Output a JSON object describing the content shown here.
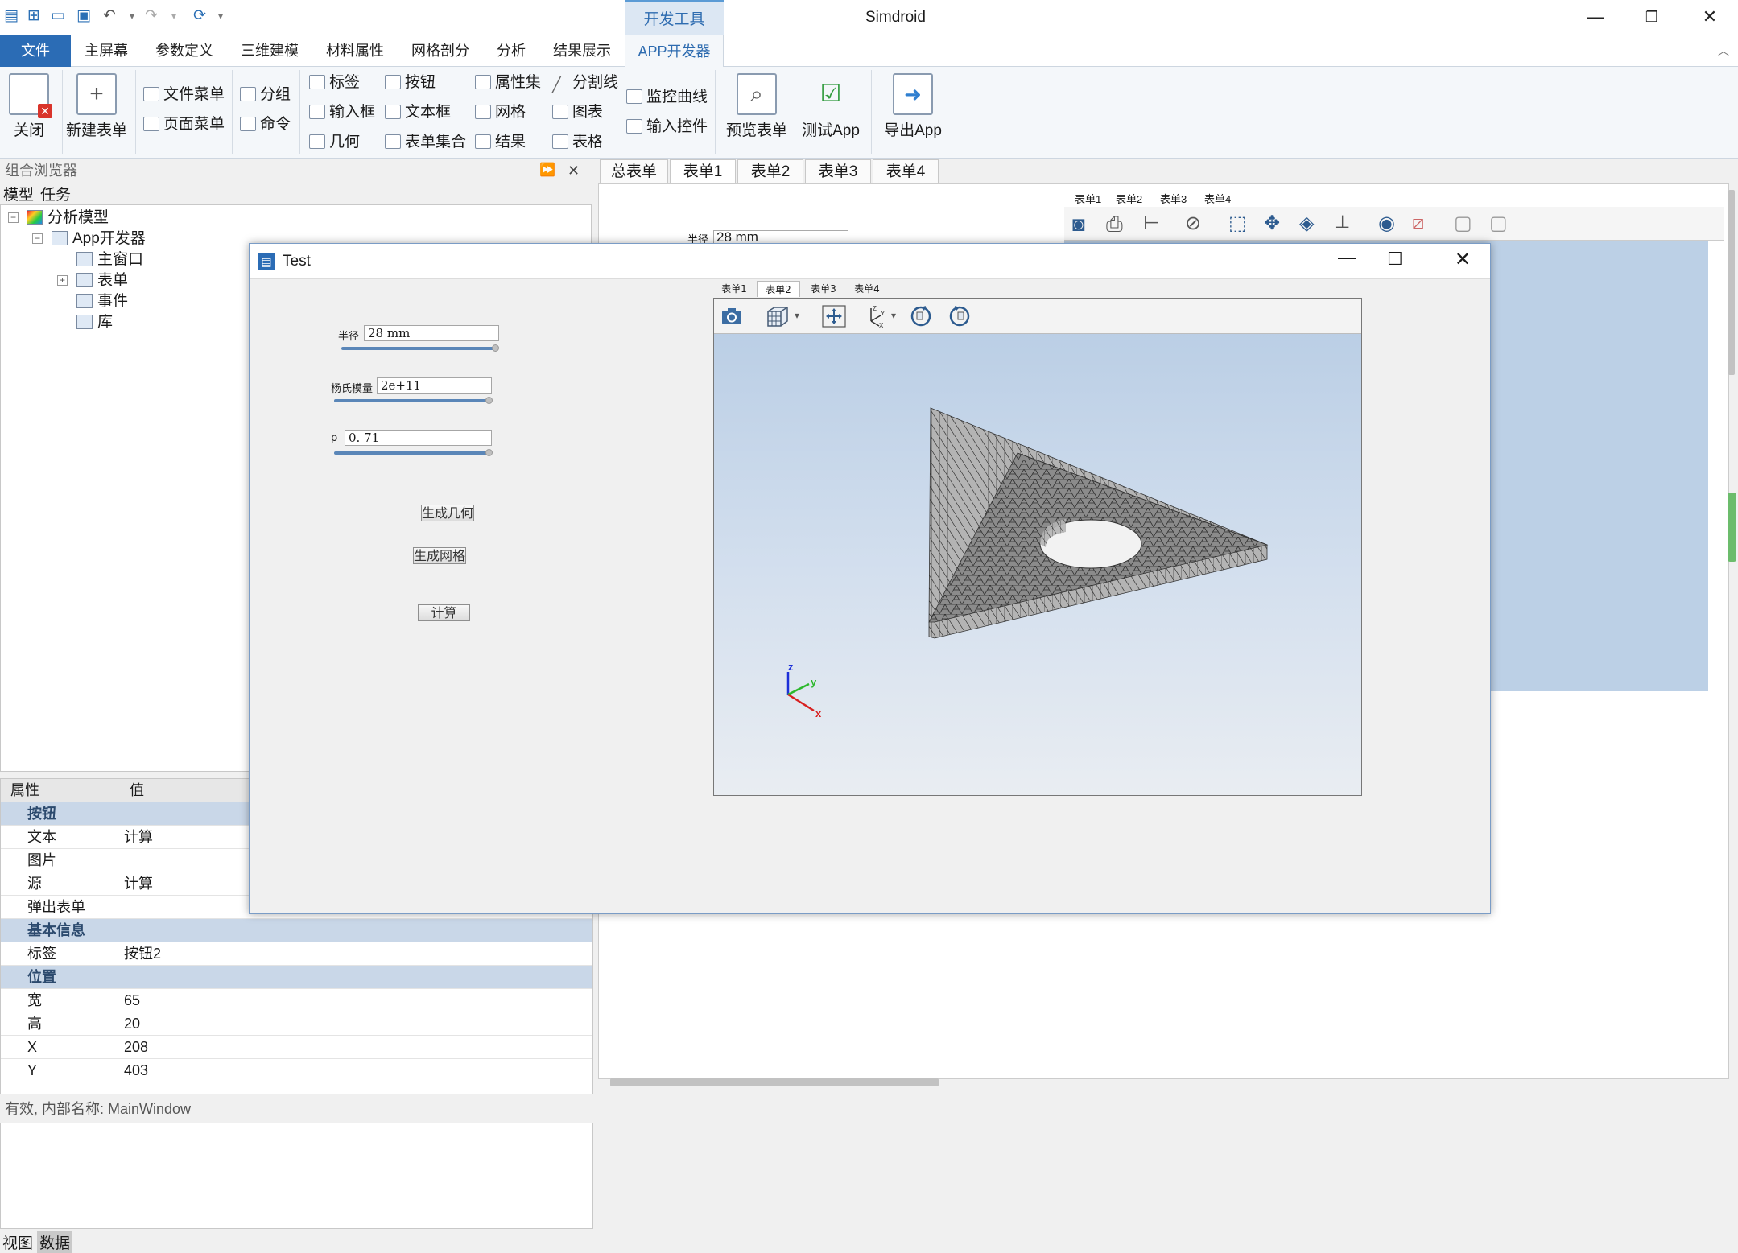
{
  "window": {
    "title": "Simdroid",
    "context_tab": "开发工具"
  },
  "menu": {
    "items": [
      "文件",
      "主屏幕",
      "参数定义",
      "三维建模",
      "材料属性",
      "网格剖分",
      "分析",
      "结果展示",
      "APP开发器"
    ]
  },
  "ribbon": {
    "close": "关闭",
    "new_form": "新建表单",
    "file_menu": "文件菜单",
    "page_menu": "页面菜单",
    "group": "分组",
    "command": "命令",
    "label": "标签",
    "input_box": "输入框",
    "geometry": "几何",
    "button": "按钮",
    "textbox": "文本框",
    "form_set": "表单集合",
    "property_set": "属性集",
    "mesh": "网格",
    "result": "结果",
    "divider": "分割线",
    "chart": "图表",
    "table": "表格",
    "monitor_curve": "监控曲线",
    "input_control": "输入控件",
    "preview_form": "预览表单",
    "test_app": "测试App",
    "export_app": "导出App"
  },
  "browser": {
    "title": "组合浏览器",
    "tabs": [
      "模型",
      "任务"
    ],
    "tree": [
      "分析模型",
      "App开发器",
      "主窗口",
      "表单",
      "事件",
      "库"
    ]
  },
  "properties": {
    "col_property": "属性",
    "col_value": "值",
    "rows": [
      {
        "type": "cat",
        "name": "按钮",
        "value": ""
      },
      {
        "type": "row",
        "name": "文本",
        "value": "计算"
      },
      {
        "type": "row",
        "name": "图片",
        "value": ""
      },
      {
        "type": "row",
        "name": "源",
        "value": "计算"
      },
      {
        "type": "row",
        "name": "弹出表单",
        "value": ""
      },
      {
        "type": "cat",
        "name": "基本信息",
        "value": ""
      },
      {
        "type": "row",
        "name": "标签",
        "value": "按钮2"
      },
      {
        "type": "cat",
        "name": "位置",
        "value": ""
      },
      {
        "type": "row",
        "name": "宽",
        "value": "65"
      },
      {
        "type": "row",
        "name": "高",
        "value": "20"
      },
      {
        "type": "row",
        "name": "X",
        "value": "208"
      },
      {
        "type": "row",
        "name": "Y",
        "value": "403"
      }
    ]
  },
  "bottom_tabs": [
    "视图",
    "数据"
  ],
  "status": "有效, 内部名称: MainWindow",
  "mdi_tabs": [
    "总表单",
    "表单1",
    "表单2",
    "表单3",
    "表单4"
  ],
  "background_form": {
    "radius_label": "半径",
    "radius_value": "28 mm",
    "tabs": [
      "表单1",
      "表单2",
      "表单3",
      "表单4"
    ]
  },
  "dialog": {
    "title": "Test",
    "fields": [
      {
        "label": "半径",
        "value": "28  mm"
      },
      {
        "label": "杨氏模量",
        "value": "2e+11"
      },
      {
        "label": "ρ",
        "value": "0. 71"
      }
    ],
    "buttons": [
      "生成几何",
      "生成网格",
      "计算"
    ],
    "tabs": [
      "表单1",
      "表单2",
      "表单3",
      "表单4"
    ],
    "axes": {
      "x": "x",
      "y": "y",
      "z": "z"
    }
  }
}
